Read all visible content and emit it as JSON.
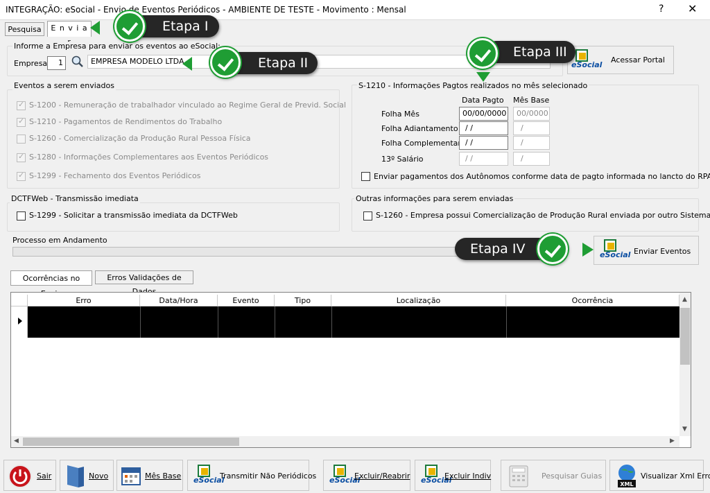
{
  "window": {
    "title": "INTEGRAÇÃO: eSocial - Envio de Eventos Periódicos - AMBIENTE DE TESTE - Movimento : Mensal",
    "help_label": "?",
    "close_label": "✕"
  },
  "top_tabs": [
    {
      "label": "Pesquisa",
      "active": false
    },
    {
      "label": "E n v i a r",
      "active": true
    }
  ],
  "empresa_section": {
    "legend": "Informe a Empresa para enviar os eventos ao eSocial:",
    "label": "Empresa",
    "code": "1",
    "name": "EMPRESA MODELO LTDA"
  },
  "acessar_portal": {
    "label": "Acessar Portal",
    "logo_text": "eSocial"
  },
  "eventos": {
    "legend": "Eventos a serem enviados",
    "items": [
      {
        "label": "S-1200 - Remuneração de trabalhador vinculado ao Regime Geral de Previd. Social",
        "checked": true
      },
      {
        "label": "S-1210 - Pagamentos de Rendimentos do Trabalho",
        "checked": true
      },
      {
        "label": "S-1260 - Comercialização da Produção Rural Pessoa Física",
        "checked": false
      },
      {
        "label": "S-1280 - Informações Complementares aos Eventos Periódicos",
        "checked": true
      },
      {
        "label": "S-1299 - Fechamento dos Eventos Periódicos",
        "checked": true
      }
    ]
  },
  "s1210": {
    "legend": "S-1210 - Informações Pagtos realizados no mês selecionado",
    "col_data_pagto": "Data Pagto",
    "col_mes_base": "Mês Base",
    "rows": [
      {
        "label": "Folha Mês",
        "data_pagto": "00/00/0000",
        "mes_base": "00/0000"
      },
      {
        "label": "Folha Adiantamento",
        "data_pagto": " / /",
        "mes_base": "/"
      },
      {
        "label": "Folha Complementar",
        "data_pagto": " / /",
        "mes_base": "/"
      },
      {
        "label": "13º Salário",
        "data_pagto": " / /",
        "mes_base": "/"
      }
    ],
    "autonomos_label": "Enviar pagamentos dos Autônomos conforme data de pagto informada no lancto do RPA"
  },
  "dctfweb": {
    "legend": "DCTFWeb - Transmissão imediata",
    "item": "S-1299 - Solicitar a transmissão imediata da DCTFWeb"
  },
  "outras": {
    "legend": "Outras informações para serem enviadas",
    "item": "S-1260 - Empresa possui Comercialização de Produção Rural enviada por outro Sistema"
  },
  "processo": {
    "legend": "Processo em Andamento",
    "progress": 0
  },
  "enviar_eventos": {
    "label": "Enviar Eventos",
    "logo_text": "eSocial"
  },
  "result_tabs": [
    {
      "label": "Ocorrências no Envio",
      "active": true
    },
    {
      "label": "Erros Validações de Dados",
      "active": false
    }
  ],
  "grid": {
    "columns": [
      "Erro",
      "Data/Hora",
      "Evento",
      "Tipo",
      "Localização",
      "Ocorrência"
    ]
  },
  "toolbar": [
    {
      "label": "Sair",
      "icon": "power-icon"
    },
    {
      "label": "Novo",
      "icon": "new-document-icon"
    },
    {
      "label": "Mês Base",
      "icon": "calendar-icon"
    },
    {
      "label": "Transmitir Não Periódicos",
      "icon": "esocial-icon",
      "logo_text": "eSocial"
    },
    {
      "label": "Excluir/Reabrir",
      "icon": "esocial-icon",
      "logo_text": "eSocial"
    },
    {
      "label": "Excluir Indiv",
      "icon": "esocial-icon",
      "logo_text": "eSocial"
    },
    {
      "label": "Pesquisar Guias",
      "icon": "calculator-icon",
      "disabled": true
    },
    {
      "label": "Visualizar Xml Erro",
      "icon": "xml-globe-icon",
      "icon_text": "XML"
    }
  ],
  "callouts": [
    {
      "label": "Etapa I"
    },
    {
      "label": "Etapa II"
    },
    {
      "label": "Etapa III"
    },
    {
      "label": "Etapa IV"
    }
  ],
  "colors": {
    "callout_bg": "#262626",
    "check_green": "#1f9d34",
    "esocial_blue": "#0b4ea2",
    "esocial_green": "#1a7a3a"
  }
}
